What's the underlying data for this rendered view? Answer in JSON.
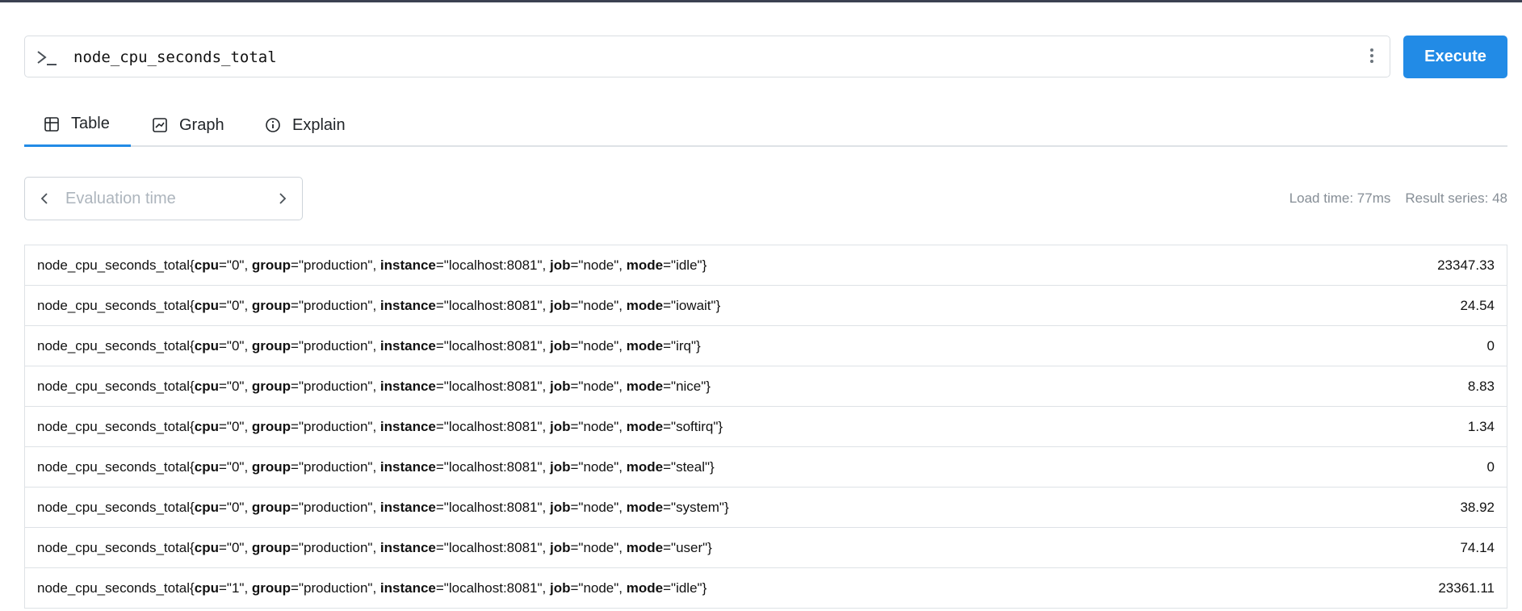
{
  "query": {
    "expression": "node_cpu_seconds_total",
    "execute_label": "Execute"
  },
  "tabs": [
    {
      "label": "Table",
      "active": true,
      "icon": "table-icon"
    },
    {
      "label": "Graph",
      "active": false,
      "icon": "graph-icon"
    },
    {
      "label": "Explain",
      "active": false,
      "icon": "info-icon"
    }
  ],
  "eval_time": {
    "placeholder": "Evaluation time"
  },
  "stats": {
    "load_time": "Load time: 77ms",
    "result_series": "Result series: 48"
  },
  "colors": {
    "accent": "#228be6",
    "border": "#dee2e6",
    "muted_text": "#868e96"
  },
  "results": {
    "metric": "node_cpu_seconds_total",
    "rows": [
      {
        "cpu": "0",
        "group": "production",
        "instance": "localhost:8081",
        "job": "node",
        "mode": "idle",
        "value": "23347.33"
      },
      {
        "cpu": "0",
        "group": "production",
        "instance": "localhost:8081",
        "job": "node",
        "mode": "iowait",
        "value": "24.54"
      },
      {
        "cpu": "0",
        "group": "production",
        "instance": "localhost:8081",
        "job": "node",
        "mode": "irq",
        "value": "0"
      },
      {
        "cpu": "0",
        "group": "production",
        "instance": "localhost:8081",
        "job": "node",
        "mode": "nice",
        "value": "8.83"
      },
      {
        "cpu": "0",
        "group": "production",
        "instance": "localhost:8081",
        "job": "node",
        "mode": "softirq",
        "value": "1.34"
      },
      {
        "cpu": "0",
        "group": "production",
        "instance": "localhost:8081",
        "job": "node",
        "mode": "steal",
        "value": "0"
      },
      {
        "cpu": "0",
        "group": "production",
        "instance": "localhost:8081",
        "job": "node",
        "mode": "system",
        "value": "38.92"
      },
      {
        "cpu": "0",
        "group": "production",
        "instance": "localhost:8081",
        "job": "node",
        "mode": "user",
        "value": "74.14"
      },
      {
        "cpu": "1",
        "group": "production",
        "instance": "localhost:8081",
        "job": "node",
        "mode": "idle",
        "value": "23361.11"
      }
    ]
  }
}
